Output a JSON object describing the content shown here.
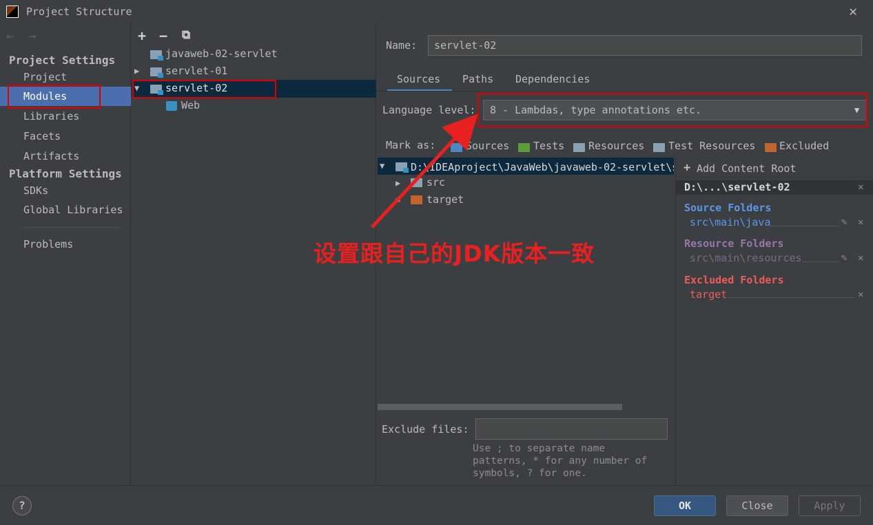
{
  "window": {
    "title": "Project Structure",
    "app_icon": "intellij-idea-icon",
    "close": "✕"
  },
  "nav": {
    "back_icon": "←",
    "forward_icon": "→",
    "project_settings_heading": "Project Settings",
    "project_items": [
      "Project",
      "Modules",
      "Libraries",
      "Facets",
      "Artifacts"
    ],
    "platform_settings_heading": "Platform Settings",
    "platform_items": [
      "SDKs",
      "Global Libraries"
    ],
    "problems": "Problems",
    "selected": "Modules"
  },
  "modules_toolbar": {
    "add": "+",
    "remove": "−",
    "copy": "⧉"
  },
  "module_tree": [
    {
      "label": "javaweb-02-servlet",
      "expanded": false,
      "has_arrow": false
    },
    {
      "label": "servlet-01",
      "expanded": false,
      "has_arrow": true
    },
    {
      "label": "servlet-02",
      "expanded": true,
      "has_arrow": true,
      "selected": true
    },
    {
      "label": "Web",
      "child": true
    }
  ],
  "module": {
    "name_label": "Name:",
    "name_value": "servlet-02",
    "tabs": [
      "Sources",
      "Paths",
      "Dependencies"
    ],
    "active_tab": "Sources",
    "language_level_label": "Language level:",
    "language_level_value": "8 - Lambdas, type annotations etc.",
    "mark_as_label": "Mark as:",
    "mark_as": [
      {
        "label": "Sources",
        "color": "#4a8ac1"
      },
      {
        "label": "Tests",
        "color": "#5c9e3a"
      },
      {
        "label": "Resources",
        "color": "#8aa1b3"
      },
      {
        "label": "Test Resources",
        "color": "#8aa1b3"
      },
      {
        "label": "Excluded",
        "color": "#c0652e"
      }
    ],
    "content_tree": {
      "root": "D:\\IDEAproject\\JavaWeb\\javaweb-02-servlet\\s",
      "children": [
        "src",
        "target"
      ]
    },
    "exclude_files_label": "Exclude files:",
    "exclude_files_value": "",
    "exclude_hint": "Use ; to separate name\npatterns, * for any number of\nsymbols, ? for one."
  },
  "content_roots": {
    "add_label": "Add Content Root",
    "root_path": "D:\\...\\servlet-02",
    "source_folders_title": "Source Folders",
    "source_folder": "src\\main\\java",
    "resource_folders_title": "Resource Folders",
    "resource_folder": "src\\main\\resources",
    "excluded_folders_title": "Excluded Folders",
    "excluded_folder": "target",
    "colors": {
      "source": "#5c97e8",
      "resource": "#9876aa",
      "excluded": "#ef5b5b"
    }
  },
  "footer": {
    "help": "?",
    "ok": "OK",
    "close": "Close",
    "apply": "Apply"
  },
  "annotation": {
    "text": "设置跟自己的JDK版本一致",
    "color": "#e00000"
  }
}
